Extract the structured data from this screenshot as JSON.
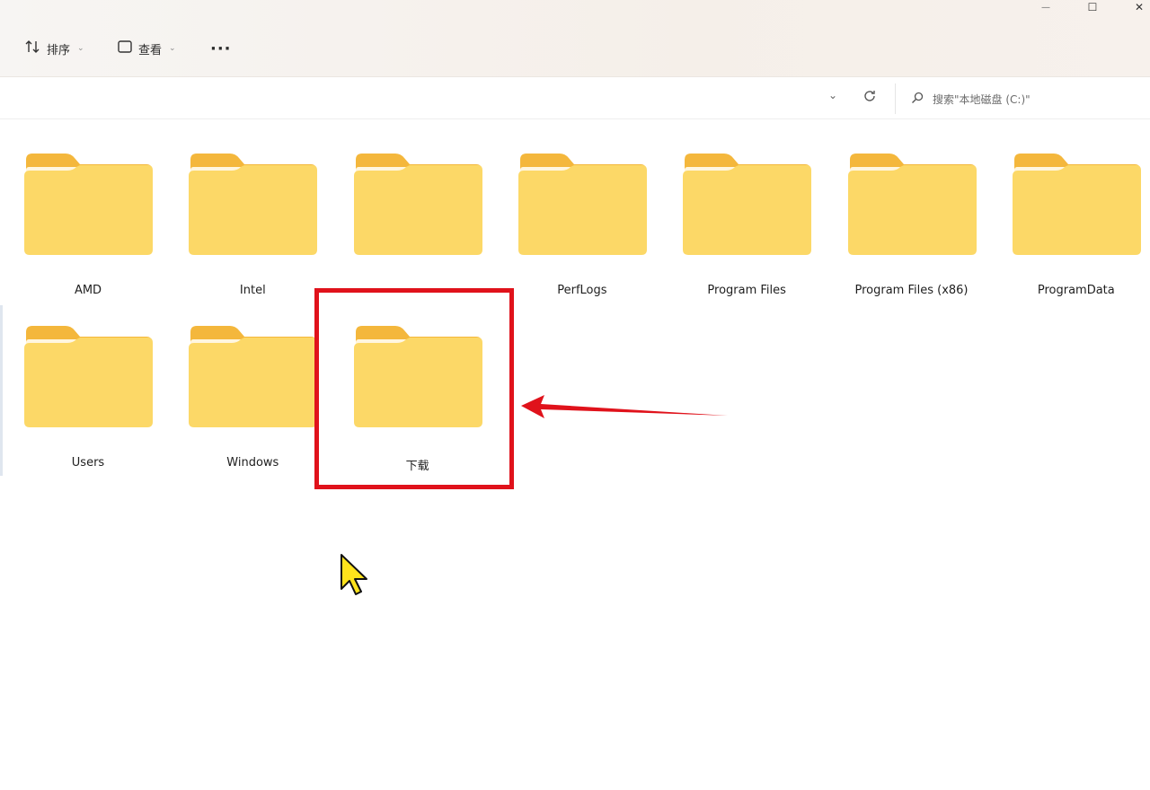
{
  "toolbar": {
    "sort_label": "排序",
    "view_label": "查看",
    "more_label": "···"
  },
  "window_controls": {
    "minimize": "—",
    "maximize": "☐",
    "close": "✕"
  },
  "address_bar": {
    "search_placeholder": "搜索\"本地磁盘 (C:)\""
  },
  "folders": [
    {
      "name": "AMD"
    },
    {
      "name": "Intel"
    },
    {
      "name": ""
    },
    {
      "name": "PerfLogs"
    },
    {
      "name": "Program Files"
    },
    {
      "name": "Program Files (x86)"
    },
    {
      "name": "ProgramData"
    },
    {
      "name": "Users"
    },
    {
      "name": "Windows"
    },
    {
      "name": "下载"
    }
  ],
  "colors": {
    "folder_back": "#f4b73c",
    "folder_front": "#fcd867",
    "highlight": "#e0121b",
    "cursor": "#ffe31c"
  }
}
